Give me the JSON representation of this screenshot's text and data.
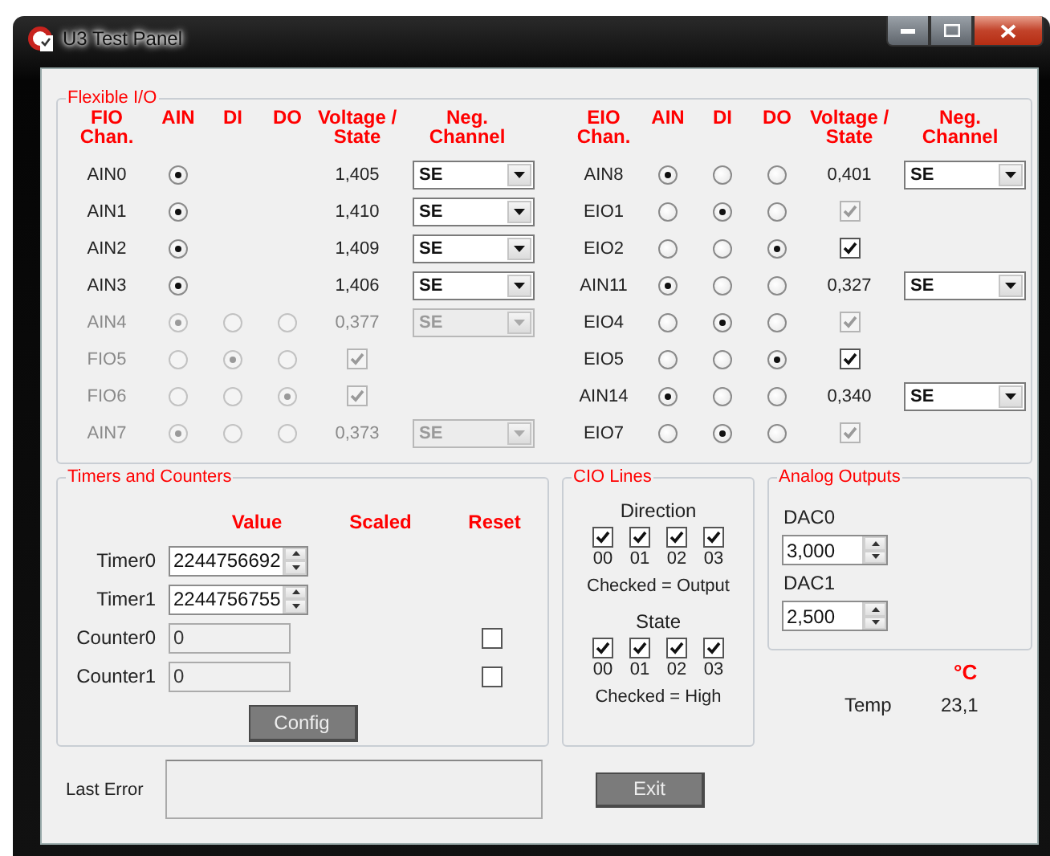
{
  "window": {
    "title": "U3 Test Panel"
  },
  "flexible_io": {
    "title": "Flexible I/O",
    "halves": [
      {
        "columns": [
          "FIO\nChan.",
          "AIN",
          "DI",
          "DO",
          "Voltage /\nState",
          "Neg.\nChannel"
        ],
        "rows": [
          {
            "channel": "AIN0",
            "disabled": false,
            "kind": "analog",
            "radios": [
              {
                "selected": true
              }
            ],
            "value": "1,405",
            "neg_channel": "SE"
          },
          {
            "channel": "AIN1",
            "disabled": false,
            "kind": "analog",
            "radios": [
              {
                "selected": true
              }
            ],
            "value": "1,410",
            "neg_channel": "SE"
          },
          {
            "channel": "AIN2",
            "disabled": false,
            "kind": "analog",
            "radios": [
              {
                "selected": true
              }
            ],
            "value": "1,409",
            "neg_channel": "SE"
          },
          {
            "channel": "AIN3",
            "disabled": false,
            "kind": "analog",
            "radios": [
              {
                "selected": true
              }
            ],
            "value": "1,406",
            "neg_channel": "SE"
          },
          {
            "channel": "AIN4",
            "disabled": true,
            "kind": "analog",
            "radios": [
              {
                "selected": true
              },
              {
                "selected": false
              },
              {
                "selected": false
              }
            ],
            "value": "0,377",
            "neg_channel": "SE"
          },
          {
            "channel": "FIO5",
            "disabled": true,
            "kind": "digital",
            "radios": [
              {
                "selected": false
              },
              {
                "selected": true
              },
              {
                "selected": false
              }
            ],
            "checkbox": {
              "checked": true,
              "disabled": true
            }
          },
          {
            "channel": "FIO6",
            "disabled": true,
            "kind": "digital",
            "radios": [
              {
                "selected": false
              },
              {
                "selected": false
              },
              {
                "selected": true
              }
            ],
            "checkbox": {
              "checked": true,
              "disabled": true
            }
          },
          {
            "channel": "AIN7",
            "disabled": true,
            "kind": "analog",
            "radios": [
              {
                "selected": true
              },
              {
                "selected": false
              },
              {
                "selected": false
              }
            ],
            "value": "0,373",
            "neg_channel": "SE"
          }
        ]
      },
      {
        "columns": [
          "EIO\nChan.",
          "AIN",
          "DI",
          "DO",
          "Voltage /\nState",
          "Neg.\nChannel"
        ],
        "rows": [
          {
            "channel": "AIN8",
            "disabled": false,
            "kind": "analog",
            "radios": [
              {
                "selected": true
              },
              {
                "selected": false
              },
              {
                "selected": false
              }
            ],
            "value": "0,401",
            "neg_channel": "SE"
          },
          {
            "channel": "EIO1",
            "disabled": false,
            "kind": "digital",
            "radios": [
              {
                "selected": false
              },
              {
                "selected": true
              },
              {
                "selected": false
              }
            ],
            "checkbox": {
              "checked": true,
              "disabled": true
            }
          },
          {
            "channel": "EIO2",
            "disabled": false,
            "kind": "digital",
            "radios": [
              {
                "selected": false
              },
              {
                "selected": false
              },
              {
                "selected": true
              }
            ],
            "checkbox": {
              "checked": true,
              "disabled": false
            }
          },
          {
            "channel": "AIN11",
            "disabled": false,
            "kind": "analog",
            "radios": [
              {
                "selected": true
              },
              {
                "selected": false
              },
              {
                "selected": false
              }
            ],
            "value": "0,327",
            "neg_channel": "SE"
          },
          {
            "channel": "EIO4",
            "disabled": false,
            "kind": "digital",
            "radios": [
              {
                "selected": false
              },
              {
                "selected": true
              },
              {
                "selected": false
              }
            ],
            "checkbox": {
              "checked": true,
              "disabled": true
            }
          },
          {
            "channel": "EIO5",
            "disabled": false,
            "kind": "digital",
            "radios": [
              {
                "selected": false
              },
              {
                "selected": false
              },
              {
                "selected": true
              }
            ],
            "checkbox": {
              "checked": true,
              "disabled": false
            }
          },
          {
            "channel": "AIN14",
            "disabled": false,
            "kind": "analog",
            "radios": [
              {
                "selected": true
              },
              {
                "selected": false
              },
              {
                "selected": false
              }
            ],
            "value": "0,340",
            "neg_channel": "SE"
          },
          {
            "channel": "EIO7",
            "disabled": false,
            "kind": "digital",
            "radios": [
              {
                "selected": false
              },
              {
                "selected": true
              },
              {
                "selected": false
              }
            ],
            "checkbox": {
              "checked": true,
              "disabled": true
            }
          }
        ]
      }
    ]
  },
  "timers": {
    "title": "Timers and Counters",
    "columns": [
      "Value",
      "Scaled",
      "Reset"
    ],
    "rows": [
      {
        "label": "Timer0",
        "kind": "spinner",
        "value": "2244756692"
      },
      {
        "label": "Timer1",
        "kind": "spinner",
        "value": "2244756755"
      },
      {
        "label": "Counter0",
        "kind": "counter",
        "value": "0",
        "reset_checked": false
      },
      {
        "label": "Counter1",
        "kind": "counter",
        "value": "0",
        "reset_checked": false
      }
    ],
    "button": "Config"
  },
  "cio_lines": {
    "title": "CIO Lines",
    "groups": [
      {
        "heading": "Direction",
        "lines": [
          {
            "label": "00",
            "checked": true
          },
          {
            "label": "01",
            "checked": true
          },
          {
            "label": "02",
            "checked": true
          },
          {
            "label": "03",
            "checked": true
          }
        ],
        "caption": "Checked = Output"
      },
      {
        "heading": "State",
        "lines": [
          {
            "label": "00",
            "checked": true
          },
          {
            "label": "01",
            "checked": true
          },
          {
            "label": "02",
            "checked": true
          },
          {
            "label": "03",
            "checked": true
          }
        ],
        "caption": "Checked = High"
      }
    ]
  },
  "analog_outputs": {
    "title": "Analog Outputs",
    "outputs": [
      {
        "label": "DAC0",
        "value": "3,000"
      },
      {
        "label": "DAC1",
        "value": "2,500"
      }
    ]
  },
  "temperature": {
    "unit": "°C",
    "label": "Temp",
    "value": "23,1"
  },
  "footer": {
    "error_label": "Last Error",
    "exit_button": "Exit"
  }
}
